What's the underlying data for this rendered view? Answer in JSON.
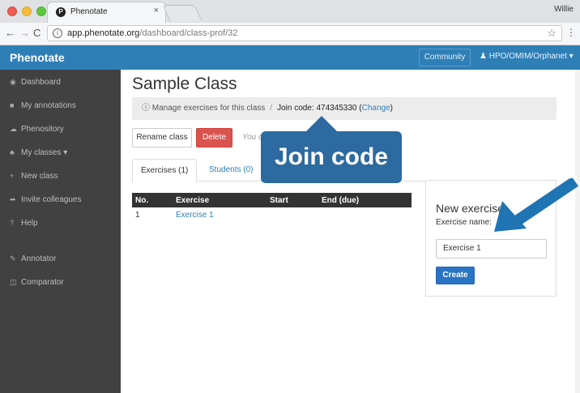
{
  "browser": {
    "tab_title": "Phenotate",
    "profile_name": "Willie",
    "url_host": "app.phenotate.org",
    "url_path": "/dashboard/class-prof/32"
  },
  "appbar": {
    "brand": "Phenotate",
    "community": "Community",
    "ontology": "HPO/OMIM/Orphanet"
  },
  "sidebar": {
    "items": [
      {
        "label": "Dashboard",
        "icon": "dashboard-icon"
      },
      {
        "label": "My annotations",
        "icon": "folder-icon"
      },
      {
        "label": "Phenository",
        "icon": "cloud-icon"
      },
      {
        "label": "My classes",
        "icon": "users-icon"
      },
      {
        "label": "New class",
        "icon": "plus-icon"
      },
      {
        "label": "Invite colleagues",
        "icon": "share-icon"
      },
      {
        "label": "Help",
        "icon": "question-icon"
      },
      {
        "label": "Annotator",
        "icon": "pencil-icon"
      },
      {
        "label": "Comparator",
        "icon": "columns-icon"
      }
    ]
  },
  "main": {
    "title": "Sample Class",
    "crumb": {
      "manage": "Manage exercises for this class",
      "join_code": "Join code: 474345330",
      "change": "Change"
    },
    "buttons": {
      "rename": "Rename class",
      "delete": "Delete",
      "hint": "You ca"
    },
    "tabs": [
      {
        "label": "Exercises (1)",
        "active": true
      },
      {
        "label": "Students (0)",
        "active": false
      },
      {
        "label": "E",
        "active": false
      }
    ],
    "table": {
      "headers": [
        "No.",
        "Exercise",
        "Start",
        "End (due)"
      ],
      "rows": [
        [
          "1",
          "Exercise 1",
          "",
          ""
        ]
      ]
    },
    "new_exercise": {
      "title": "New exercise",
      "label": "Exercise name:",
      "value": "Exercise 1",
      "create": "Create"
    }
  },
  "annotation": {
    "callout": "Join code",
    "color": "#2c6aa0"
  }
}
